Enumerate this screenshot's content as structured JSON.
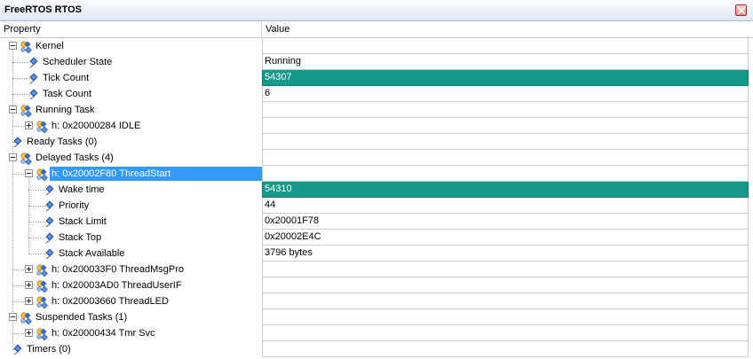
{
  "window": {
    "title": "FreeRTOS RTOS"
  },
  "columns": {
    "property": "Property",
    "value": "Value"
  },
  "colors": {
    "changed_value_bg": "#16998a",
    "selection_bg": "#3399ff"
  },
  "rows": [
    {
      "label": "Kernel",
      "value": "",
      "level": 0,
      "icon": "group-icon",
      "expander": "expanded"
    },
    {
      "label": "Scheduler State",
      "value": "Running",
      "level": 1,
      "icon": "property-icon"
    },
    {
      "label": "Tick Count",
      "value": "54307",
      "level": 1,
      "icon": "property-icon",
      "changed": true
    },
    {
      "label": "Task Count",
      "value": "6",
      "level": 1,
      "icon": "property-icon"
    },
    {
      "label": "Running Task",
      "value": "",
      "level": 0,
      "icon": "group-icon",
      "expander": "expanded"
    },
    {
      "label": "h: 0x20000284 IDLE",
      "value": "",
      "level": 1,
      "icon": "group-icon",
      "expander": "collapsed"
    },
    {
      "label": "Ready Tasks (0)",
      "value": "",
      "level": 0,
      "icon": "property-icon"
    },
    {
      "label": "Delayed Tasks (4)",
      "value": "",
      "level": 0,
      "icon": "group-icon",
      "expander": "expanded"
    },
    {
      "label": "h: 0x20002F80 ThreadStart",
      "value": "",
      "level": 1,
      "icon": "group-icon",
      "expander": "expanded",
      "selected": true
    },
    {
      "label": "Wake time",
      "value": "54310",
      "level": 2,
      "icon": "property-icon",
      "changed": true
    },
    {
      "label": "Priority",
      "value": "44",
      "level": 2,
      "icon": "property-icon"
    },
    {
      "label": "Stack Limit",
      "value": "0x20001F78",
      "level": 2,
      "icon": "property-icon"
    },
    {
      "label": "Stack Top",
      "value": "0x20002E4C",
      "level": 2,
      "icon": "property-icon"
    },
    {
      "label": "Stack Available",
      "value": "3796 bytes",
      "level": 2,
      "icon": "property-icon"
    },
    {
      "label": "h: 0x200033F0 ThreadMsgPro",
      "value": "",
      "level": 1,
      "icon": "group-icon",
      "expander": "collapsed"
    },
    {
      "label": "h: 0x20003AD0 ThreadUserIF",
      "value": "",
      "level": 1,
      "icon": "group-icon",
      "expander": "collapsed"
    },
    {
      "label": "h: 0x20003660 ThreadLED",
      "value": "",
      "level": 1,
      "icon": "group-icon",
      "expander": "collapsed"
    },
    {
      "label": "Suspended Tasks (1)",
      "value": "",
      "level": 0,
      "icon": "group-icon",
      "expander": "expanded"
    },
    {
      "label": "h: 0x20000434 Tmr Svc",
      "value": "",
      "level": 1,
      "icon": "group-icon",
      "expander": "collapsed"
    },
    {
      "label": "Timers (0)",
      "value": "",
      "level": 0,
      "icon": "property-icon"
    }
  ]
}
